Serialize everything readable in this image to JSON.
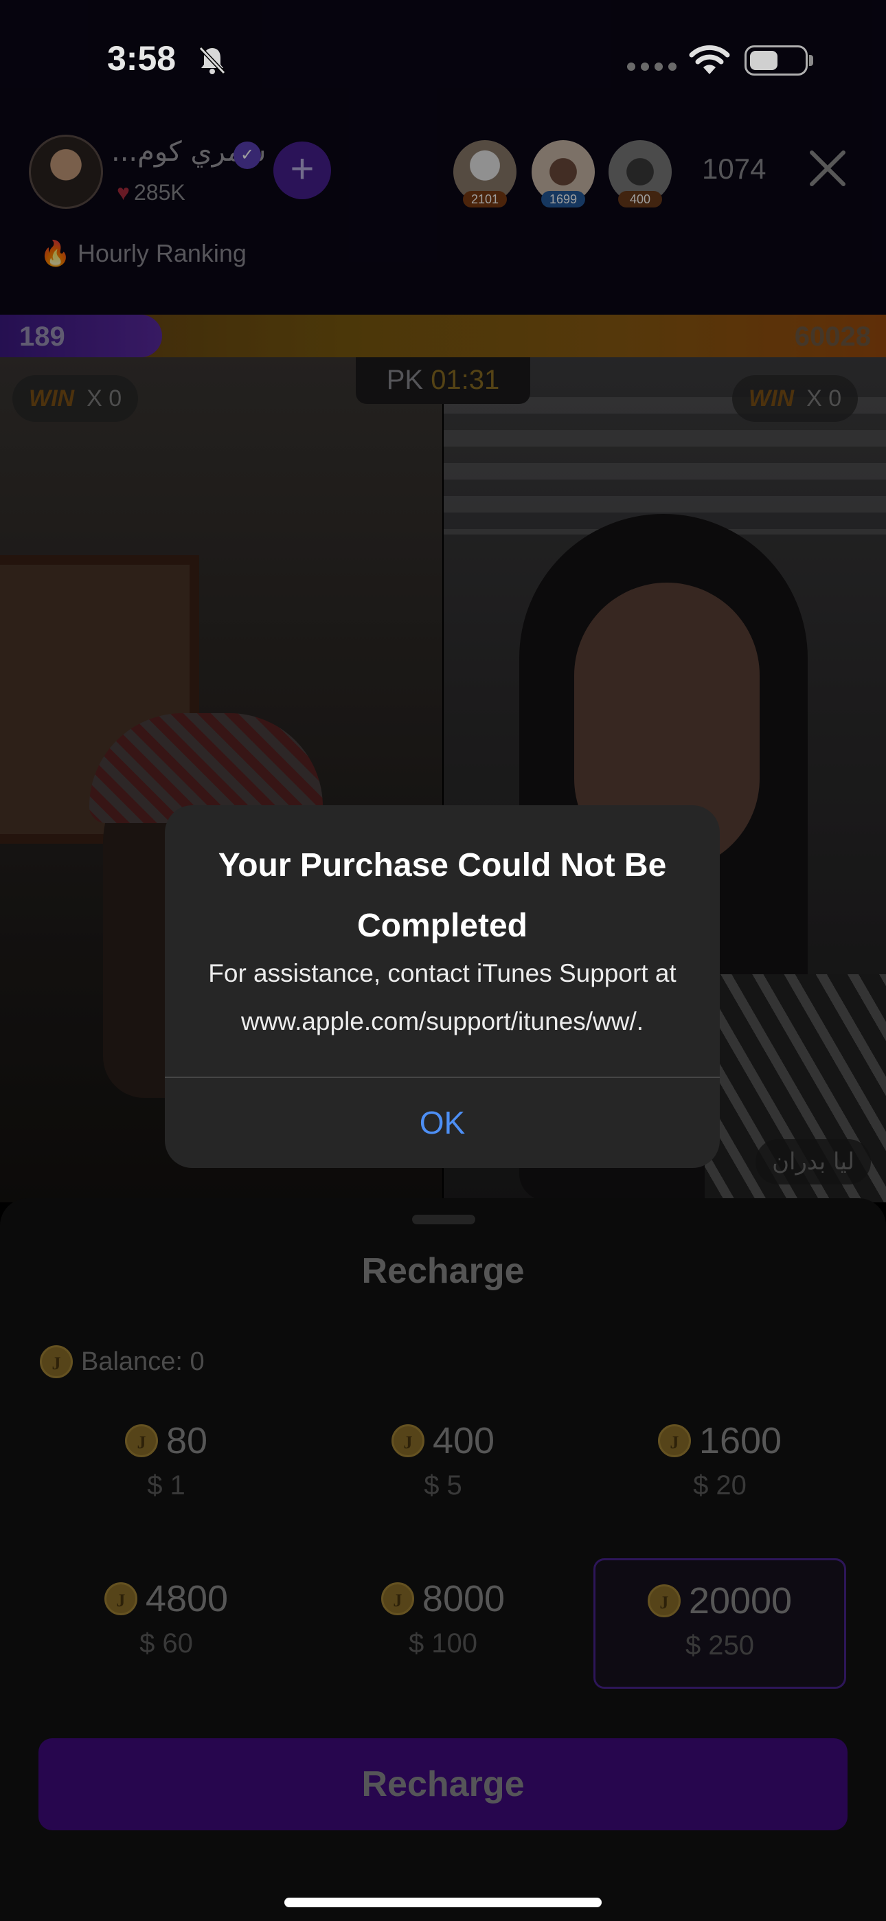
{
  "status_bar": {
    "time": "3:58"
  },
  "live": {
    "host": {
      "name": "...شمري كوم",
      "likes": "285K"
    },
    "follow_label": "+",
    "top_viewers": [
      {
        "badge": "2101",
        "badge_color": "#7a3a12"
      },
      {
        "badge": "1699",
        "badge_color": "#245a9a"
      },
      {
        "badge": "400",
        "badge_color": "#6a3a1a"
      }
    ],
    "viewer_count": "1074",
    "hourly_ranking": "Hourly Ranking",
    "pk": {
      "left_score": "189",
      "right_score": "60028",
      "label": "PK",
      "timer": "01:31",
      "win_label": "WIN",
      "left_wins": "X 0",
      "right_wins": "X 0"
    },
    "opponent_name": "ليا بدران"
  },
  "alert": {
    "title": "Your Purchase Could Not Be Completed",
    "message": "For assistance, contact iTunes Support at www.apple.com/support/itunes/ww/.",
    "ok_label": "OK"
  },
  "recharge": {
    "title": "Recharge",
    "balance_label": "Balance: 0",
    "coin_symbol": "J",
    "packages": [
      {
        "coins": "80",
        "price": "$ 1"
      },
      {
        "coins": "400",
        "price": "$ 5"
      },
      {
        "coins": "1600",
        "price": "$ 20"
      },
      {
        "coins": "4800",
        "price": "$ 60"
      },
      {
        "coins": "8000",
        "price": "$ 100"
      },
      {
        "coins": "20000",
        "price": "$ 250",
        "selected": true
      }
    ],
    "button_label": "Recharge"
  },
  "colors": {
    "accent_purple": "#5b12b8",
    "alert_link": "#4d8ff5",
    "coin_gold": "#d4a93b"
  }
}
